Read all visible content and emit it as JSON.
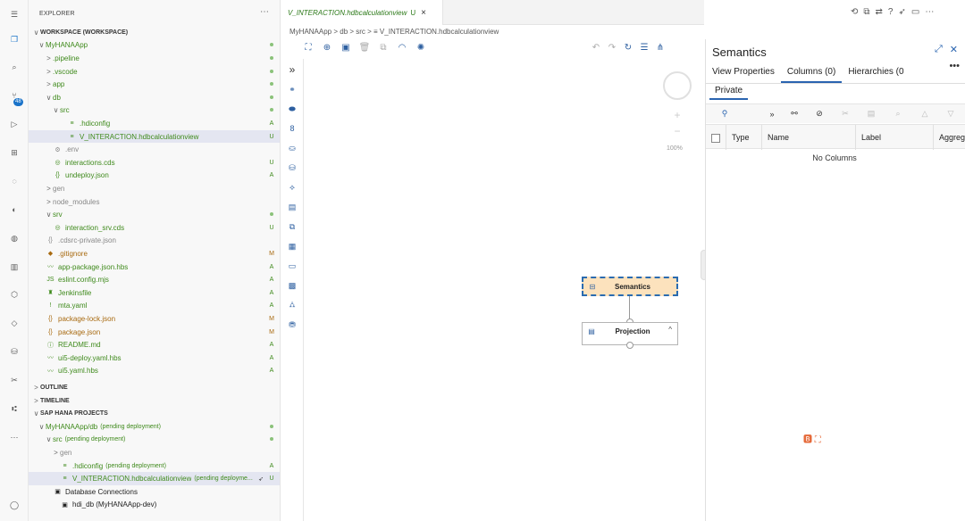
{
  "activity_bar": {
    "items": [
      "menu-icon",
      "explorer-icon",
      "search-icon",
      "source-control-icon",
      "run-debug-icon",
      "extensions-icon",
      "remote-icon",
      "deploy-icon",
      "cloud-icon",
      "library-icon",
      "hana-icon",
      "diamond-icon",
      "database-icon",
      "tools-icon",
      "git-graph-icon",
      "more-icon"
    ],
    "badge": "48"
  },
  "explorer": {
    "title": "EXPLORER",
    "more": "⋯",
    "tree": [
      {
        "label": "WORKSPACE (WORKSPACE)",
        "tw": "∨",
        "color": "c-dark",
        "indent": 4,
        "sec": true
      },
      {
        "label": "MyHANAApp",
        "tw": "∨",
        "color": "c-green",
        "indent": 10,
        "dot": true
      },
      {
        "label": ".pipeline",
        "tw": ">",
        "color": "c-green",
        "indent": 18,
        "dot": true
      },
      {
        "label": ".vscode",
        "tw": ">",
        "color": "c-green",
        "indent": 18,
        "dot": true
      },
      {
        "label": "app",
        "tw": ">",
        "color": "c-green",
        "indent": 18,
        "dot": true
      },
      {
        "label": "db",
        "tw": "∨",
        "color": "c-green",
        "indent": 18,
        "dot": true
      },
      {
        "label": "src",
        "tw": "∨",
        "color": "c-green",
        "indent": 26,
        "dot": true
      },
      {
        "label": ".hdiconfig",
        "icon": "≡",
        "color": "c-green",
        "indent": 34,
        "status": "A"
      },
      {
        "label": "V_INTERACTION.hdbcalculationview",
        "icon": "≡",
        "color": "c-green",
        "indent": 34,
        "status": "U",
        "sel": true
      },
      {
        "label": ".env",
        "icon": "⚙",
        "color": "c-gray",
        "indent": 18
      },
      {
        "label": "interactions.cds",
        "icon": "◎",
        "color": "c-green",
        "indent": 18,
        "status": "U"
      },
      {
        "label": "undeploy.json",
        "icon": "{}",
        "color": "c-green",
        "indent": 18,
        "status": "A"
      },
      {
        "label": "gen",
        "tw": ">",
        "color": "c-gray",
        "indent": 18
      },
      {
        "label": "node_modules",
        "tw": ">",
        "color": "c-gray",
        "indent": 18
      },
      {
        "label": "srv",
        "tw": "∨",
        "color": "c-green",
        "indent": 18,
        "dot": true
      },
      {
        "label": "interaction_srv.cds",
        "icon": "◎",
        "color": "c-green",
        "indent": 18,
        "status": "U"
      },
      {
        "label": ".cdsrc-private.json",
        "icon": "{}",
        "color": "c-gray",
        "indent": 10
      },
      {
        "label": ".gitignore",
        "icon": "◆",
        "color": "c-orange",
        "indent": 10,
        "status": "M"
      },
      {
        "label": "app-package.json.hbs",
        "icon": "〰",
        "color": "c-green",
        "indent": 10,
        "status": "A"
      },
      {
        "label": "eslint.config.mjs",
        "icon": "JS",
        "color": "c-green",
        "indent": 10,
        "status": "A"
      },
      {
        "label": "Jenkinsfile",
        "icon": "♜",
        "color": "c-green",
        "indent": 10,
        "status": "A"
      },
      {
        "label": "mta.yaml",
        "icon": "!",
        "color": "c-green",
        "indent": 10,
        "status": "A"
      },
      {
        "label": "package-lock.json",
        "icon": "{}",
        "color": "c-orange",
        "indent": 10,
        "status": "M"
      },
      {
        "label": "package.json",
        "icon": "{}",
        "color": "c-orange",
        "indent": 10,
        "status": "M"
      },
      {
        "label": "README.md",
        "icon": "ⓘ",
        "color": "c-green",
        "indent": 10,
        "status": "A"
      },
      {
        "label": "ui5-deploy.yaml.hbs",
        "icon": "〰",
        "color": "c-green",
        "indent": 10,
        "status": "A"
      },
      {
        "label": "ui5.yaml.hbs",
        "icon": "〰",
        "color": "c-green",
        "indent": 10,
        "status": "A"
      }
    ],
    "sections": [
      {
        "label": "OUTLINE"
      },
      {
        "label": "TIMELINE"
      }
    ],
    "hana": [
      {
        "label": "SAP HANA PROJECTS",
        "tw": "∨",
        "color": "c-dark",
        "indent": 4,
        "sec": true
      },
      {
        "label": "MyHANAApp/db",
        "suffix": "(pending deployment)",
        "tw": "∨",
        "color": "c-green",
        "indent": 10,
        "dot": true
      },
      {
        "label": "src",
        "suffix": "(pending deployment)",
        "tw": "∨",
        "color": "c-green",
        "indent": 18,
        "dot": true
      },
      {
        "label": "gen",
        "tw": ">",
        "color": "c-gray",
        "indent": 26
      },
      {
        "label": ".hdiconfig",
        "suffix": "(pending deployment)",
        "icon": "≡",
        "color": "c-green",
        "indent": 26,
        "status": "A"
      },
      {
        "label": "V_INTERACTION.hdbcalculationview",
        "suffix": "(pending deployme...",
        "icon": "≡",
        "color": "c-green",
        "indent": 26,
        "status": "U",
        "sel": true,
        "pin": "🚀"
      },
      {
        "label": "Database Connections",
        "icon": "▣",
        "color": "c-dark",
        "indent": 18
      },
      {
        "label": "hdi_db (MyHANAApp-dev)",
        "icon": "▣",
        "color": "c-dark",
        "indent": 26
      }
    ]
  },
  "editor": {
    "tab_label": "V_INTERACTION.hdbcalculationview",
    "tab_status": "U",
    "tab_close": "×",
    "breadcrumb": "MyHANAApp > db > src > ≡ V_INTERACTION.hdbcalculationview",
    "zoom": "100%",
    "nodes": {
      "semantics": "Semantics",
      "projection": "Projection",
      "projection_collapse": "^"
    }
  },
  "semantics_panel": {
    "title": "Semantics",
    "expand": "⤢",
    "close": "✕",
    "tabs": [
      "View Properties",
      "Columns (0)",
      "Hierarchies (0"
    ],
    "more": "•••",
    "subtab": "Private",
    "columns": [
      "Type",
      "Name",
      "Label",
      "Aggreg"
    ],
    "empty": "No Columns"
  }
}
